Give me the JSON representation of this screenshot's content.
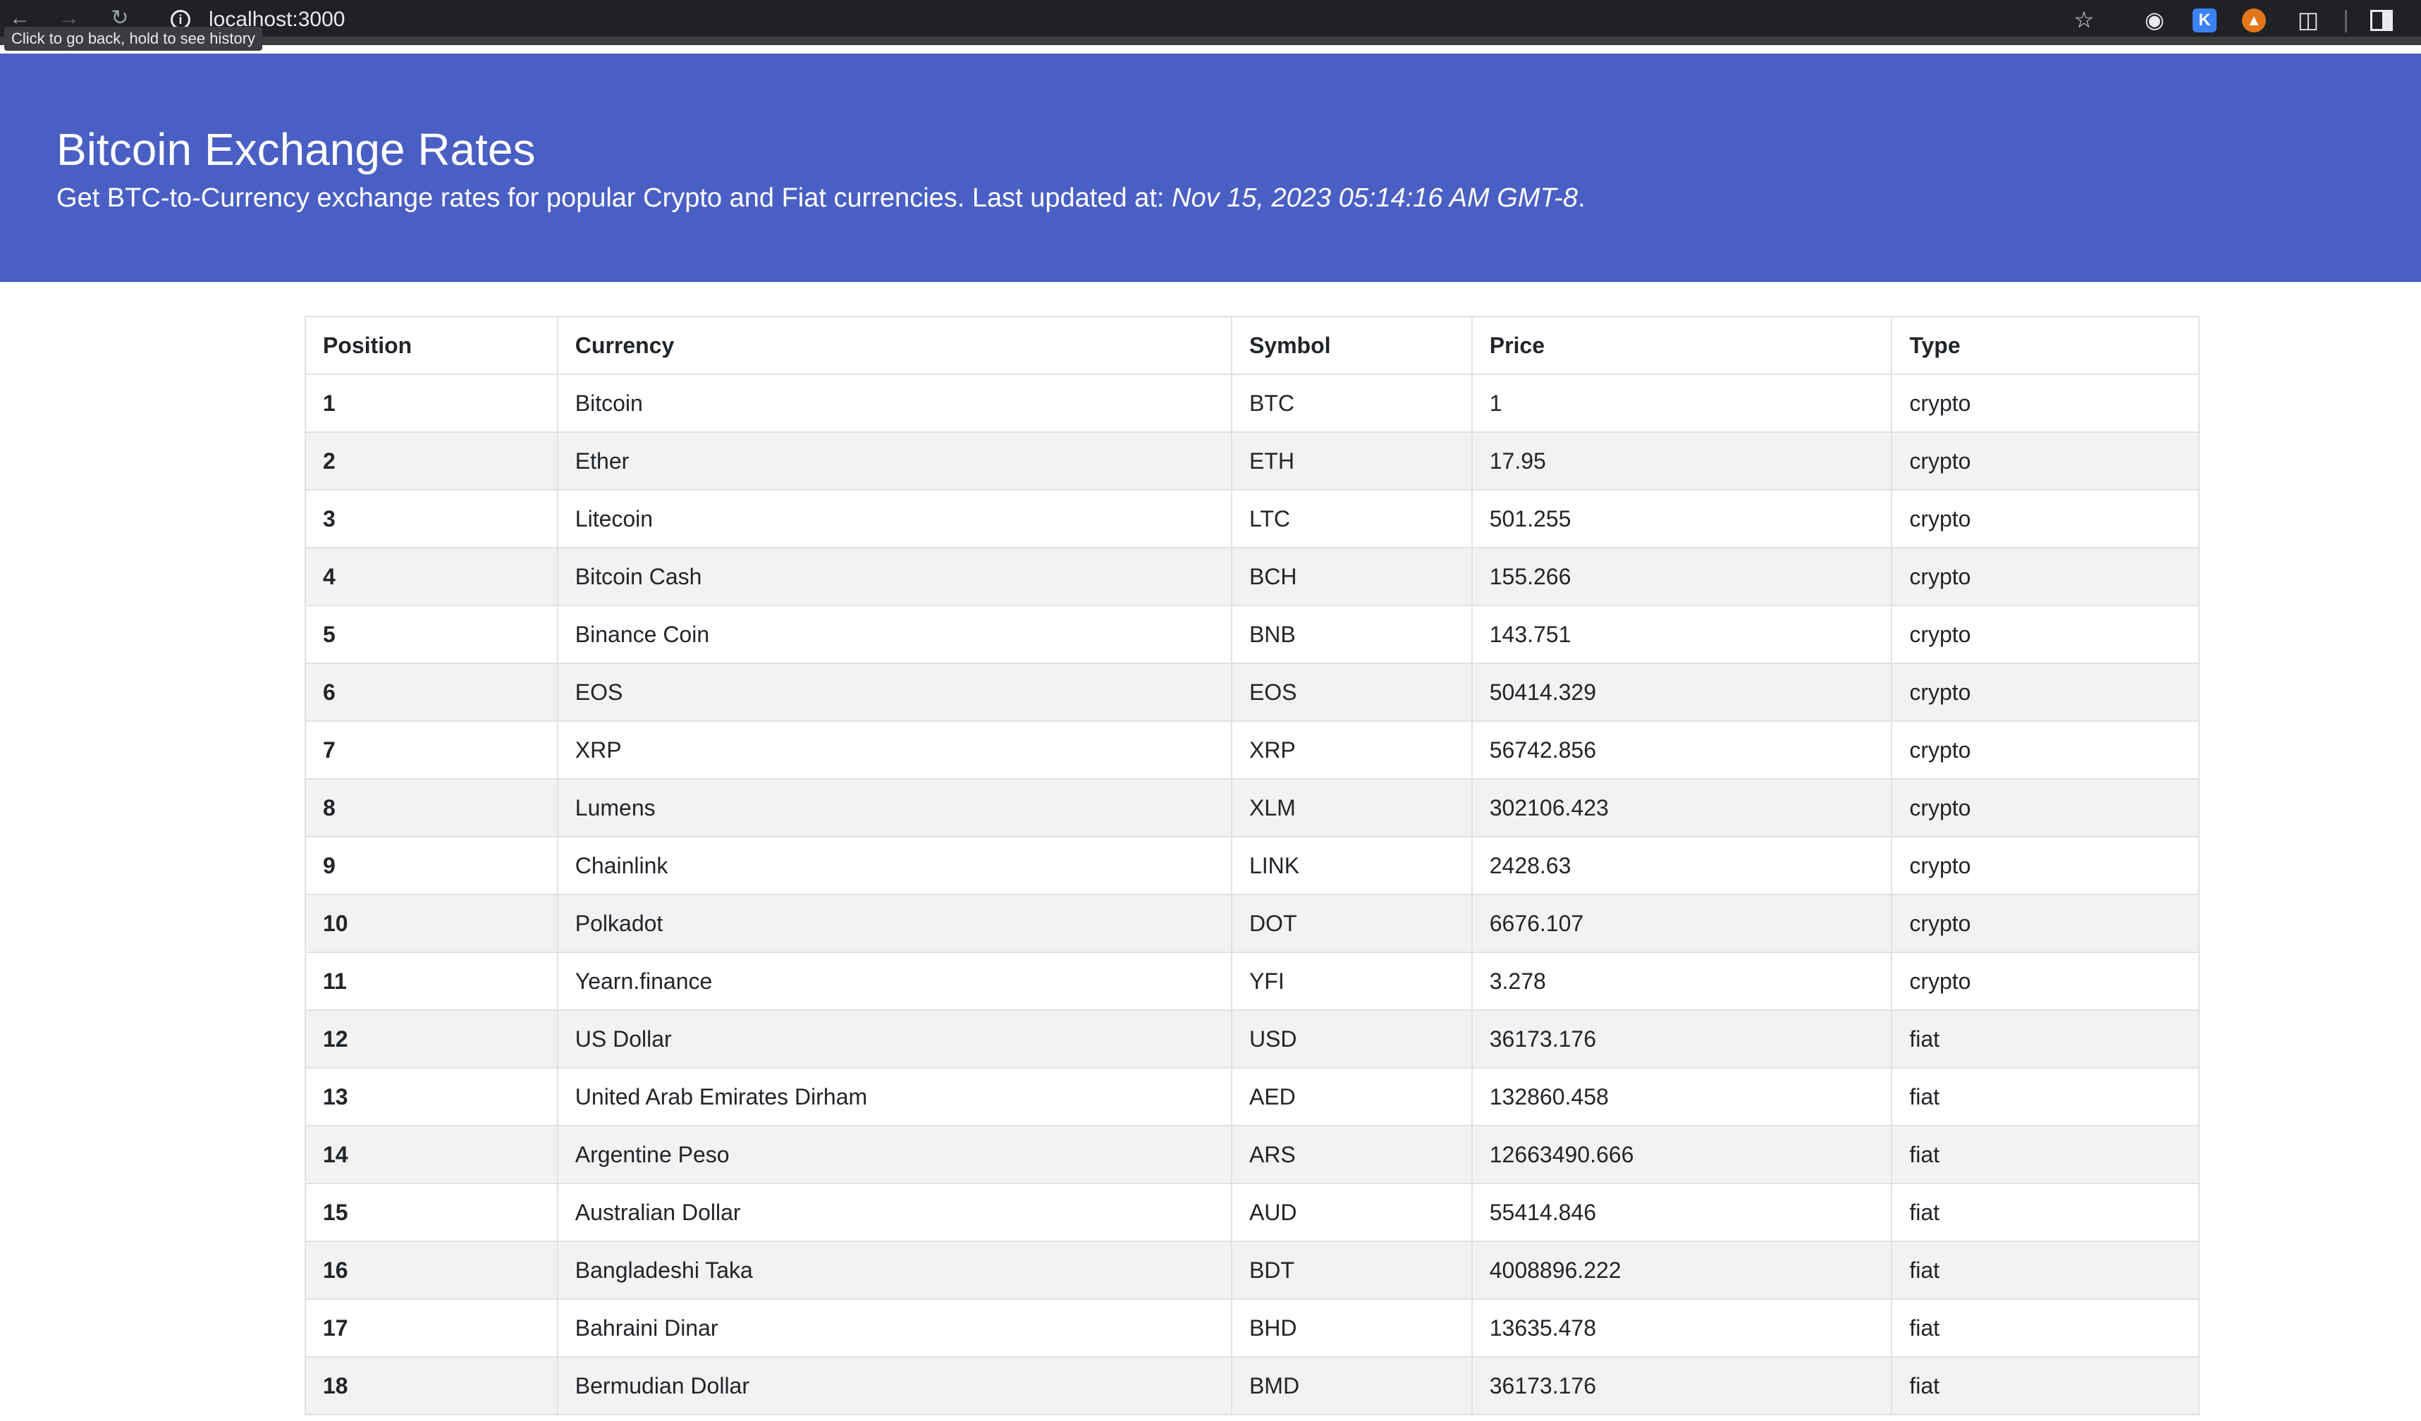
{
  "browser": {
    "url": "localhost:3000",
    "tooltip": "Click to go back, hold to see history",
    "icons": [
      "back-arrow-icon",
      "forward-arrow-icon",
      "reload-icon",
      "site-info-icon",
      "bookmark-star-icon",
      "record-icon",
      "k-extension-icon",
      "metamask-fox-icon",
      "extensions-puzzle-icon",
      "side-panel-icon"
    ],
    "ext_k_label": "K"
  },
  "hero": {
    "title": "Bitcoin Exchange Rates",
    "subtitle_prefix": "Get BTC-to-Currency exchange rates for popular Crypto and Fiat currencies. Last updated at: ",
    "last_updated": "Nov 15, 2023 05:14:16 AM GMT-8",
    "subtitle_suffix": ".",
    "background_color": "#4a5fc4"
  },
  "table": {
    "headers": {
      "position": "Position",
      "currency": "Currency",
      "symbol": "Symbol",
      "price": "Price",
      "type": "Type"
    },
    "rows": [
      {
        "position": "1",
        "currency": "Bitcoin",
        "symbol": "BTC",
        "price": "1",
        "type": "crypto"
      },
      {
        "position": "2",
        "currency": "Ether",
        "symbol": "ETH",
        "price": "17.95",
        "type": "crypto"
      },
      {
        "position": "3",
        "currency": "Litecoin",
        "symbol": "LTC",
        "price": "501.255",
        "type": "crypto"
      },
      {
        "position": "4",
        "currency": "Bitcoin Cash",
        "symbol": "BCH",
        "price": "155.266",
        "type": "crypto"
      },
      {
        "position": "5",
        "currency": "Binance Coin",
        "symbol": "BNB",
        "price": "143.751",
        "type": "crypto"
      },
      {
        "position": "6",
        "currency": "EOS",
        "symbol": "EOS",
        "price": "50414.329",
        "type": "crypto"
      },
      {
        "position": "7",
        "currency": "XRP",
        "symbol": "XRP",
        "price": "56742.856",
        "type": "crypto"
      },
      {
        "position": "8",
        "currency": "Lumens",
        "symbol": "XLM",
        "price": "302106.423",
        "type": "crypto"
      },
      {
        "position": "9",
        "currency": "Chainlink",
        "symbol": "LINK",
        "price": "2428.63",
        "type": "crypto"
      },
      {
        "position": "10",
        "currency": "Polkadot",
        "symbol": "DOT",
        "price": "6676.107",
        "type": "crypto"
      },
      {
        "position": "11",
        "currency": "Yearn.finance",
        "symbol": "YFI",
        "price": "3.278",
        "type": "crypto"
      },
      {
        "position": "12",
        "currency": "US Dollar",
        "symbol": "USD",
        "price": "36173.176",
        "type": "fiat"
      },
      {
        "position": "13",
        "currency": "United Arab Emirates Dirham",
        "symbol": "AED",
        "price": "132860.458",
        "type": "fiat"
      },
      {
        "position": "14",
        "currency": "Argentine Peso",
        "symbol": "ARS",
        "price": "12663490.666",
        "type": "fiat"
      },
      {
        "position": "15",
        "currency": "Australian Dollar",
        "symbol": "AUD",
        "price": "55414.846",
        "type": "fiat"
      },
      {
        "position": "16",
        "currency": "Bangladeshi Taka",
        "symbol": "BDT",
        "price": "4008896.222",
        "type": "fiat"
      },
      {
        "position": "17",
        "currency": "Bahraini Dinar",
        "symbol": "BHD",
        "price": "13635.478",
        "type": "fiat"
      },
      {
        "position": "18",
        "currency": "Bermudian Dollar",
        "symbol": "BMD",
        "price": "36173.176",
        "type": "fiat"
      }
    ]
  }
}
